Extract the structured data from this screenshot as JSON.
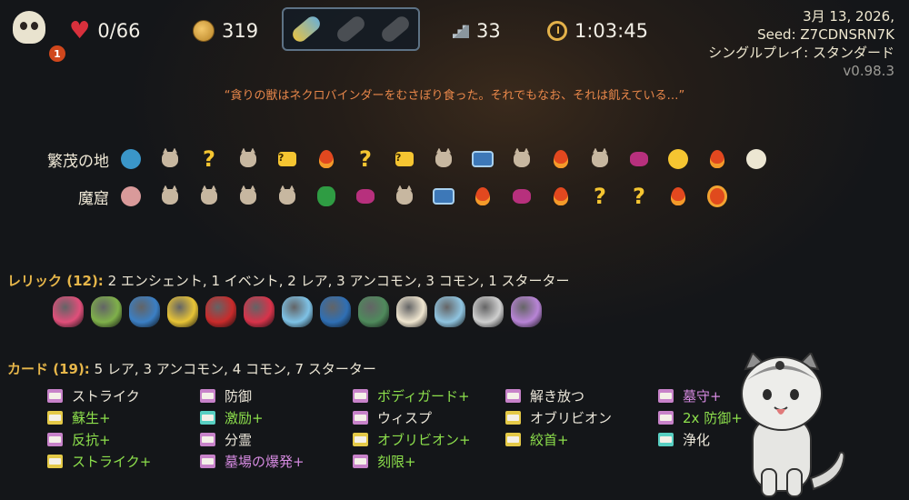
{
  "top_bar": {
    "ascension_level": "1",
    "hp": "0/66",
    "gold": "319",
    "floor": "33",
    "time": "1:03:45",
    "potion_slots": [
      "filled",
      "empty",
      "empty"
    ]
  },
  "run_info": {
    "date": "3月 13, 2026,",
    "seed": "Seed: Z7CDNSRN7K",
    "mode": "シングルプレイ: スタンダード",
    "version": "v0.98.3"
  },
  "death_quote": "“貪りの獣はネクロバインダーをむさぼり食った。それでもなお、それは飢えている…”",
  "acts": [
    {
      "name": "繁茂の地",
      "nodes": [
        "ancient-icon",
        "monster-icon",
        "unknown-icon",
        "monster-icon",
        "treasure-icon",
        "rest-icon",
        "unknown-icon",
        "treasure-icon",
        "monster-icon",
        "shop-icon",
        "monster-icon",
        "rest-icon",
        "monster-icon",
        "elite-icon",
        "unknown-elite-icon",
        "rest-icon",
        "boss-icon"
      ]
    },
    {
      "name": "魔窟",
      "nodes": [
        "ancient-icon",
        "monster-icon",
        "monster-icon",
        "monster-icon",
        "monster-icon",
        "gold-bag-icon",
        "elite-icon",
        "monster-icon",
        "shop-icon",
        "rest-icon",
        "elite-icon",
        "rest-icon",
        "unknown-icon",
        "unknown-icon",
        "rest-icon",
        "boss-icon"
      ]
    }
  ],
  "relics": {
    "heading": "レリック (12):",
    "summary": "2 エンシェント, 1 イベント, 2 レア, 3 アンコモン, 3 コモン, 1 スターター",
    "colors": [
      "#e04f7a",
      "#7fb04a",
      "#3b7fc4",
      "#e8c436",
      "#c92b2b",
      "#d8334a",
      "#7ec2e6",
      "#2f6fb4",
      "#4f8a5c",
      "#f0e6d0",
      "#8fc4e0",
      "#cfcfcf",
      "#b884d6"
    ]
  },
  "cards": {
    "heading": "カード (19):",
    "summary": "5 レア, 3 アンコモン, 4 コモン, 7 スターター",
    "list": [
      {
        "label": "ストライク",
        "color": "white",
        "icon": "#c782c9"
      },
      {
        "label": "蘇生+",
        "color": "green",
        "icon": "#e4c947"
      },
      {
        "label": "反抗+",
        "color": "green",
        "icon": "#c782c9"
      },
      {
        "label": "ストライク+",
        "color": "green",
        "icon": "#e4c947"
      },
      {
        "label": "防御",
        "color": "white",
        "icon": "#c782c9"
      },
      {
        "label": "激励+",
        "color": "green",
        "icon": "#58cfc2"
      },
      {
        "label": "分霊",
        "color": "white",
        "icon": "#c782c9"
      },
      {
        "label": "墓場の爆発+",
        "color": "purple",
        "icon": "#c782c9"
      },
      {
        "label": "ボディガード+",
        "color": "green",
        "icon": "#c782c9"
      },
      {
        "label": "ウィスプ",
        "color": "white",
        "icon": "#c782c9"
      },
      {
        "label": "オブリビオン+",
        "color": "green",
        "icon": "#e4c947"
      },
      {
        "label": "刻限+",
        "color": "green",
        "icon": "#c782c9"
      },
      {
        "label": "解き放つ",
        "color": "white",
        "icon": "#c782c9"
      },
      {
        "label": "オブリビオン",
        "color": "white",
        "icon": "#e4c947"
      },
      {
        "label": "絞首+",
        "color": "green",
        "icon": "#e4c947"
      },
      {
        "label": "墓守+",
        "color": "purple",
        "icon": "#c782c9"
      },
      {
        "label": "2x 防御+",
        "color": "green",
        "icon": "#c782c9"
      },
      {
        "label": "浄化",
        "color": "white",
        "icon": "#58cfc2"
      }
    ]
  }
}
